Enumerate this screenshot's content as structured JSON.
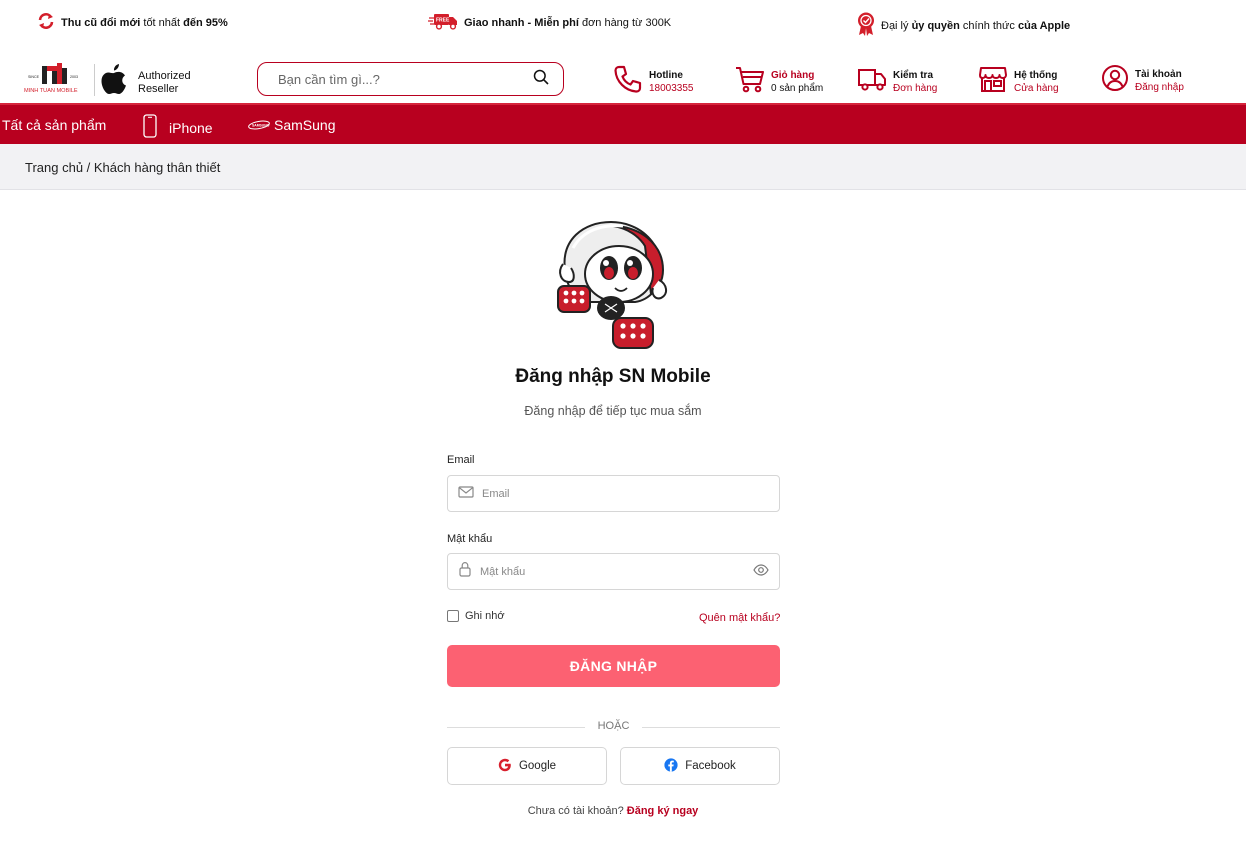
{
  "promo": {
    "trade_in": {
      "bold1": "Thu cũ đổi mới",
      "rest": " tốt nhất ",
      "bold2": "đến 95%"
    },
    "shipping": {
      "bold": "Giao nhanh - Miễn phí",
      "rest": " đơn hàng từ 300K",
      "badge": "FREE"
    },
    "authorized": {
      "pre": "Đại lý ",
      "bold1": "ủy quyền",
      "mid": " chính thức ",
      "bold2": "của Apple"
    }
  },
  "header": {
    "logo": {
      "brand": "MINH TUAN MOBILE",
      "since": "SINCE",
      "year": "2003"
    },
    "reseller": {
      "line1": "Authorized",
      "line2": "Reseller"
    },
    "search": {
      "placeholder": "Bạn cần tìm gì...?"
    },
    "hotline": {
      "title": "Hotline",
      "value": "18003355"
    },
    "cart": {
      "title": "Giỏ hàng",
      "value": "0 sản phẩm"
    },
    "order_check": {
      "title": "Kiểm tra",
      "value": "Đơn hàng"
    },
    "stores": {
      "title": "Hệ thống",
      "value": "Cửa hàng"
    },
    "account": {
      "title": "Tài khoản",
      "value": "Đăng nhập"
    }
  },
  "nav": {
    "all_products": "Tất cả sản phẩm",
    "iphone": "iPhone",
    "samsung": "SamSung",
    "samsung_logo": "SAMSUNG"
  },
  "breadcrumb": "Trang chủ / Khách hàng thân thiết",
  "login": {
    "title": "Đăng nhập SN Mobile",
    "subtitle": "Đăng nhập để tiếp tục mua sắm",
    "email_label": "Email",
    "email_placeholder": "Email",
    "password_label": "Mật khẩu",
    "password_placeholder": "Mật khẩu",
    "remember": "Ghi nhớ",
    "forgot": "Quên mật khẩu?",
    "submit": "ĐĂNG NHẬP",
    "or": "HOẶC",
    "google": "Google",
    "facebook": "Facebook",
    "no_account": "Chưa có tài khoản? ",
    "signup": "Đăng ký ngay"
  },
  "colors": {
    "brand": "#b8001f",
    "button": "#fc6172"
  }
}
